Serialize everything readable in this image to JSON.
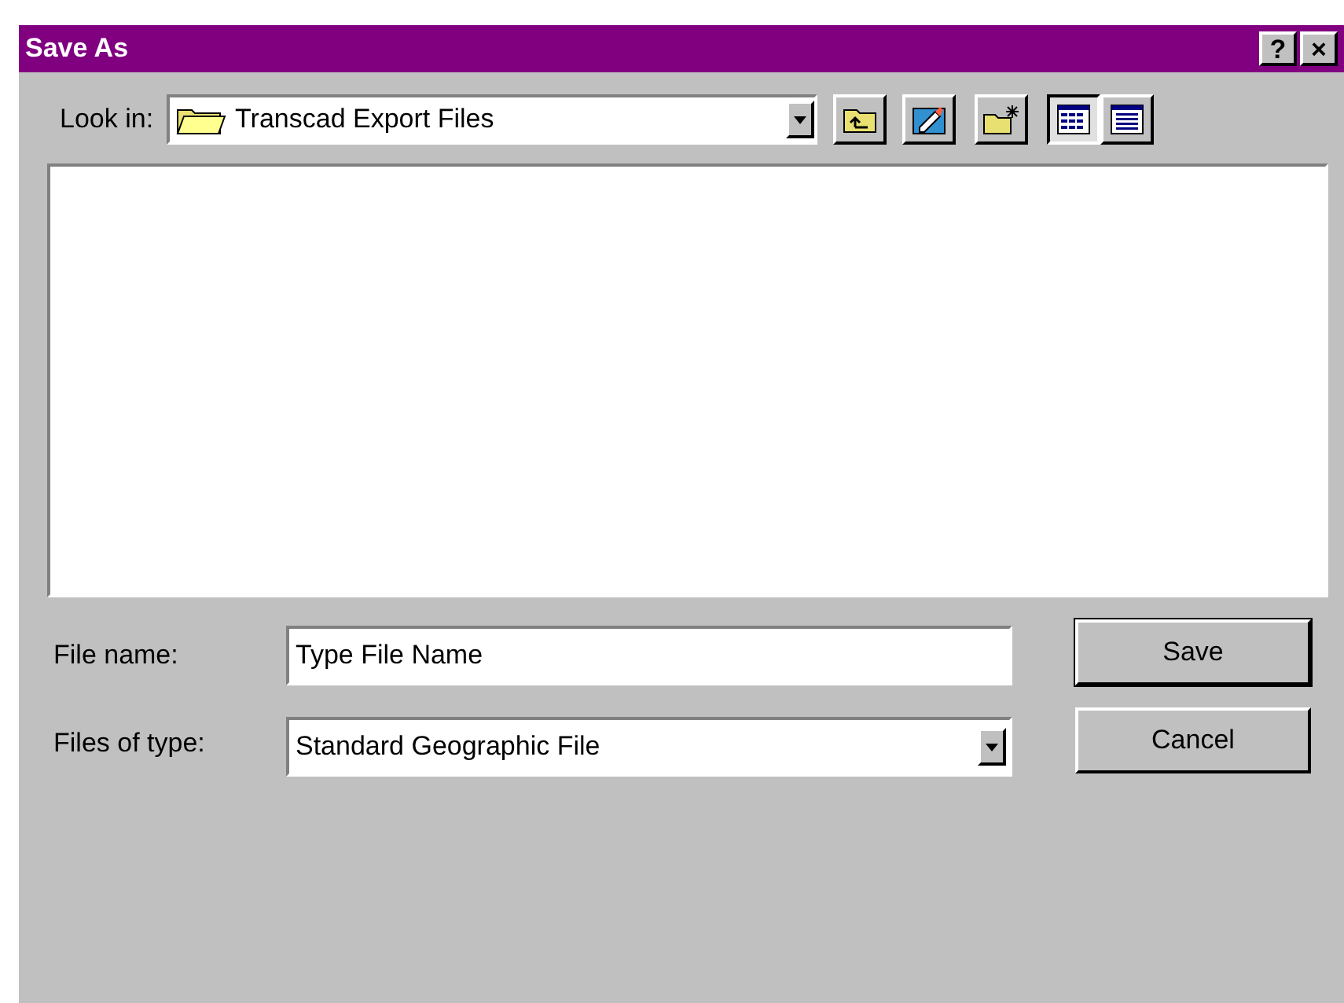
{
  "window": {
    "title": "Save As",
    "title_buttons": [
      "?",
      "×"
    ]
  },
  "look_in": {
    "label": "Look in:",
    "value": "Transcad Export Files"
  },
  "view_buttons": [
    {
      "kind": "list",
      "selected": true
    },
    {
      "kind": "details",
      "selected": false
    }
  ],
  "file_name": {
    "label": "File name:",
    "value": "Type File Name"
  },
  "file_type": {
    "label": "Files of type:",
    "value": "Standard Geographic File"
  },
  "buttons": [
    {
      "label": "Save",
      "default": true
    },
    {
      "label": "Cancel",
      "default": false
    }
  ]
}
